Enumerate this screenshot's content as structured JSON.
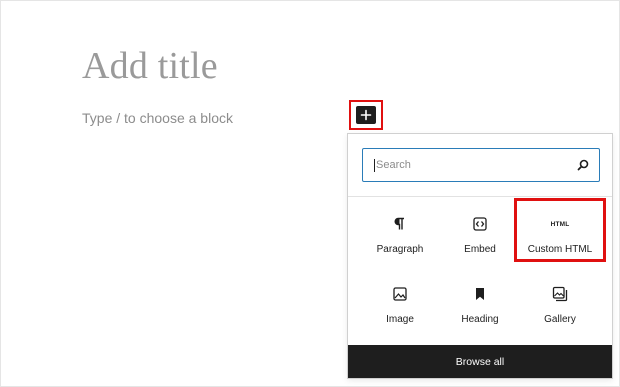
{
  "editor": {
    "title_placeholder": "Add title",
    "block_placeholder": "Type / to choose a block"
  },
  "inserter": {
    "search_placeholder": "Search",
    "blocks": [
      {
        "label": "Paragraph",
        "icon": "paragraph-icon"
      },
      {
        "label": "Embed",
        "icon": "embed-icon"
      },
      {
        "label": "Custom HTML",
        "icon": "html-icon",
        "icon_text": "HTML"
      },
      {
        "label": "Image",
        "icon": "image-icon"
      },
      {
        "label": "Heading",
        "icon": "heading-icon"
      },
      {
        "label": "Gallery",
        "icon": "gallery-icon"
      }
    ],
    "browse_all_label": "Browse all"
  },
  "colors": {
    "highlight": "#e01010",
    "focus_border": "#2a7cb8",
    "dark": "#1e1e1e"
  }
}
